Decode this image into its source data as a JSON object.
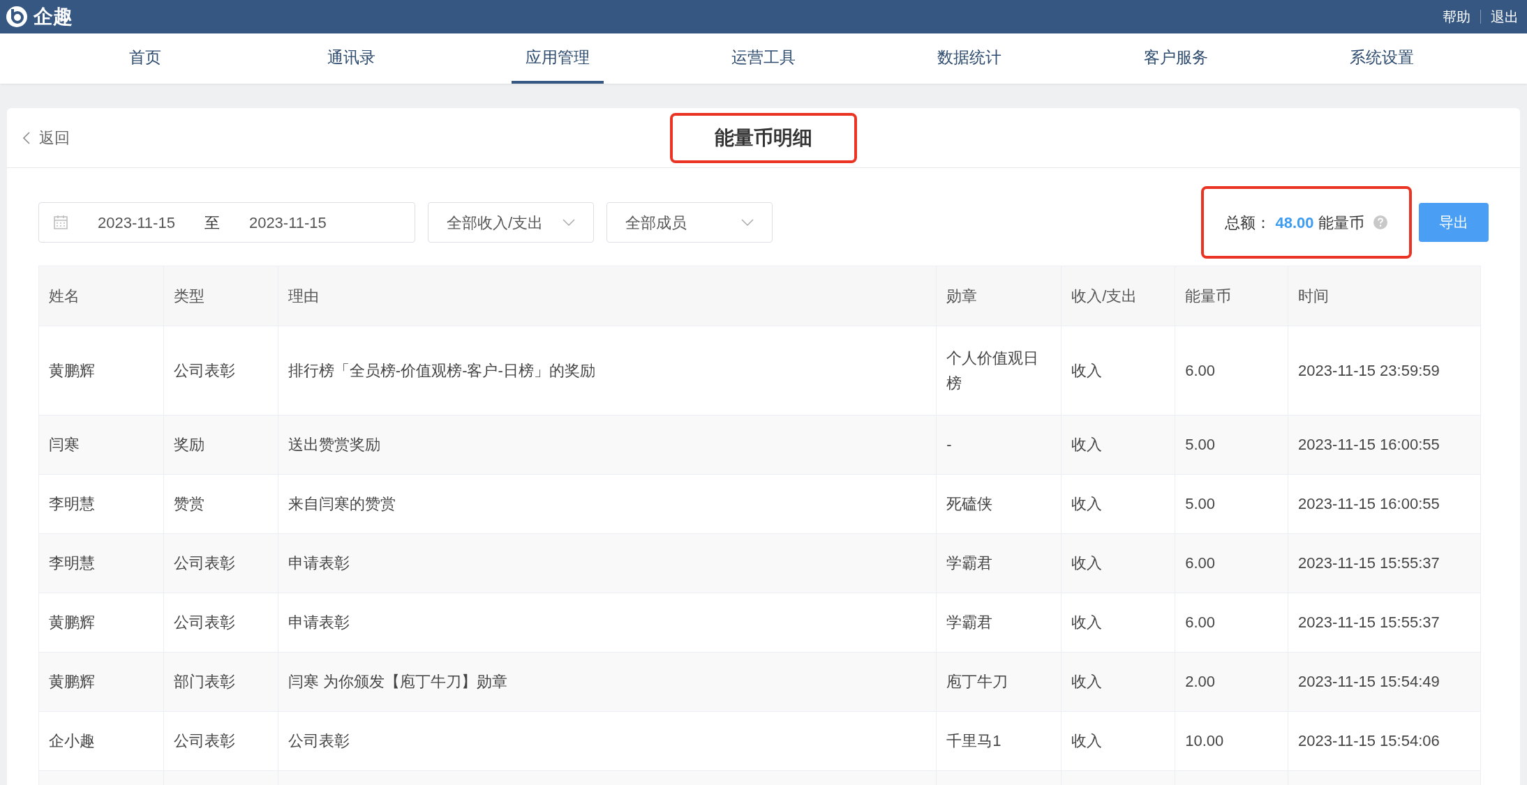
{
  "top_bar": {
    "logo": "企趣",
    "links": [
      "帮助",
      "退出"
    ]
  },
  "nav": [
    {
      "label": "首页",
      "selected": false
    },
    {
      "label": "通讯录",
      "selected": false
    },
    {
      "label": "应用管理",
      "selected": true
    },
    {
      "label": "运营工具",
      "selected": false
    },
    {
      "label": "数据统计",
      "selected": false
    },
    {
      "label": "客户服务",
      "selected": false
    },
    {
      "label": "系统设置",
      "selected": false
    }
  ],
  "page": {
    "back": "返回",
    "title": "能量币明细",
    "title_highlighted": true
  },
  "filters": {
    "date_from": "2023-11-15",
    "date_sep": "至",
    "date_to": "2023-11-15",
    "type_select": "全部收入/支出",
    "member_select": "全部成员"
  },
  "total": {
    "label": "总额：",
    "amount": "48.00",
    "unit": "能量币",
    "highlighted": true
  },
  "export_button": "导出",
  "table": {
    "columns": [
      "姓名",
      "类型",
      "理由",
      "勋章",
      "收入/支出",
      "能量币",
      "时间"
    ],
    "rows": [
      [
        "黄鹏辉",
        "公司表彰",
        "排行榜「全员榜-价值观榜-客户-日榜」的奖励",
        "个人价值观日榜",
        "收入",
        "6.00",
        "2023-11-15 23:59:59"
      ],
      [
        "闫寒",
        "奖励",
        "送出赞赏奖励",
        "-",
        "收入",
        "5.00",
        "2023-11-15 16:00:55"
      ],
      [
        "李明慧",
        "赞赏",
        "来自闫寒的赞赏",
        "死磕侠",
        "收入",
        "5.00",
        "2023-11-15 16:00:55"
      ],
      [
        "李明慧",
        "公司表彰",
        "申请表彰",
        "学霸君",
        "收入",
        "6.00",
        "2023-11-15 15:55:37"
      ],
      [
        "黄鹏辉",
        "公司表彰",
        "申请表彰",
        "学霸君",
        "收入",
        "6.00",
        "2023-11-15 15:55:37"
      ],
      [
        "黄鹏辉",
        "部门表彰",
        "闫寒 为你颁发【庖丁牛刀】勋章",
        "庖丁牛刀",
        "收入",
        "2.00",
        "2023-11-15 15:54:49"
      ],
      [
        "企小趣",
        "公司表彰",
        "公司表彰",
        "千里马1",
        "收入",
        "10.00",
        "2023-11-15 15:54:06"
      ]
    ]
  }
}
